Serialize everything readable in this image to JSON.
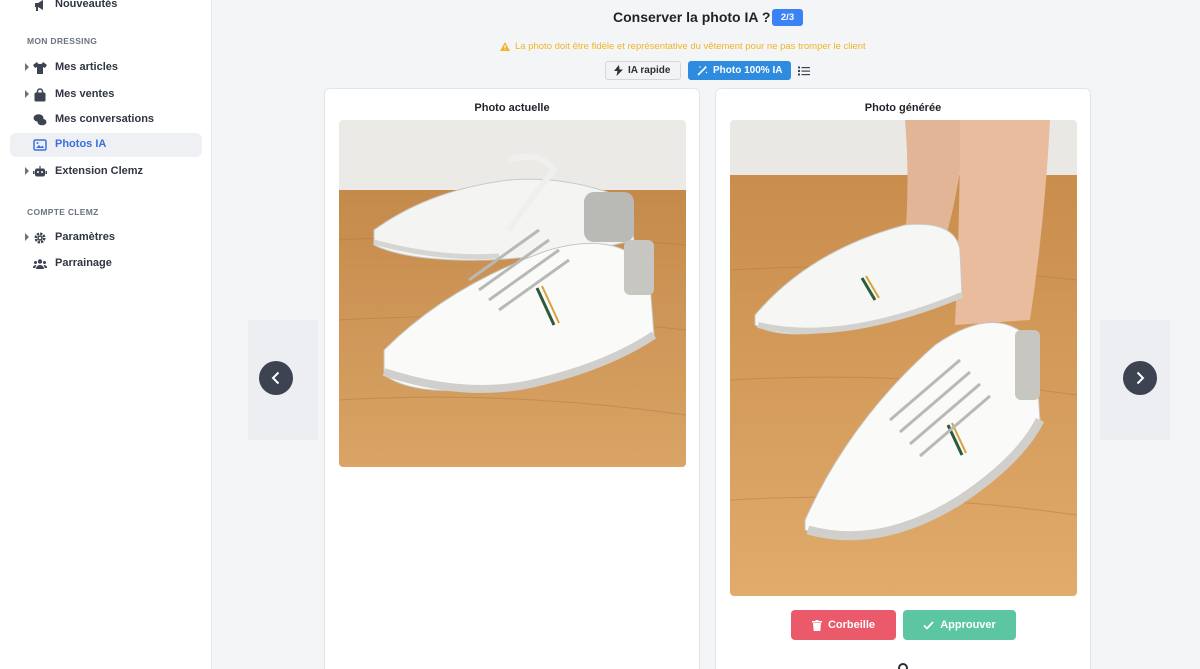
{
  "sidebar": {
    "top_item": {
      "label": "Nouveautés",
      "icon": "megaphone-icon"
    },
    "section_dressing": "MON DRESSING",
    "items": [
      {
        "label": "Mes articles",
        "icon": "shirt-icon",
        "expandable": true
      },
      {
        "label": "Mes ventes",
        "icon": "bag-icon",
        "expandable": true
      },
      {
        "label": "Mes conversations",
        "icon": "chat-icon",
        "expandable": false
      },
      {
        "label": "Photos IA",
        "icon": "image-icon",
        "expandable": false,
        "active": true
      },
      {
        "label": "Extension Clemz",
        "icon": "robot-icon",
        "expandable": true
      }
    ],
    "section_compte": "COMPTE CLEMZ",
    "compte_items": [
      {
        "label": "Paramètres",
        "icon": "gear-icon",
        "expandable": true
      },
      {
        "label": "Parrainage",
        "icon": "users-icon",
        "expandable": false
      }
    ]
  },
  "header": {
    "title": "Conserver la photo IA ?",
    "counter": "2/3",
    "warning": "La photo doit être fidèle et représentative du vêtement pour ne pas tromper le client",
    "modes": [
      {
        "label": "IA rapide",
        "icon": "bolt-icon",
        "selected": false
      },
      {
        "label": "Photo 100% IA",
        "icon": "magic-wand-icon",
        "selected": true
      }
    ]
  },
  "current_photo": {
    "title": "Photo actuelle"
  },
  "generated_photo": {
    "title": "Photo générée"
  },
  "actions": {
    "trash": "Corbeille",
    "approve": "Approuver"
  },
  "colors": {
    "accent": "#3b82f6",
    "mode_selected": "#2d8ce0",
    "trash": "#ea5a6a",
    "approve": "#5cc6a2",
    "warning": "#f0b429",
    "active_nav_text": "#3a6fe0"
  }
}
